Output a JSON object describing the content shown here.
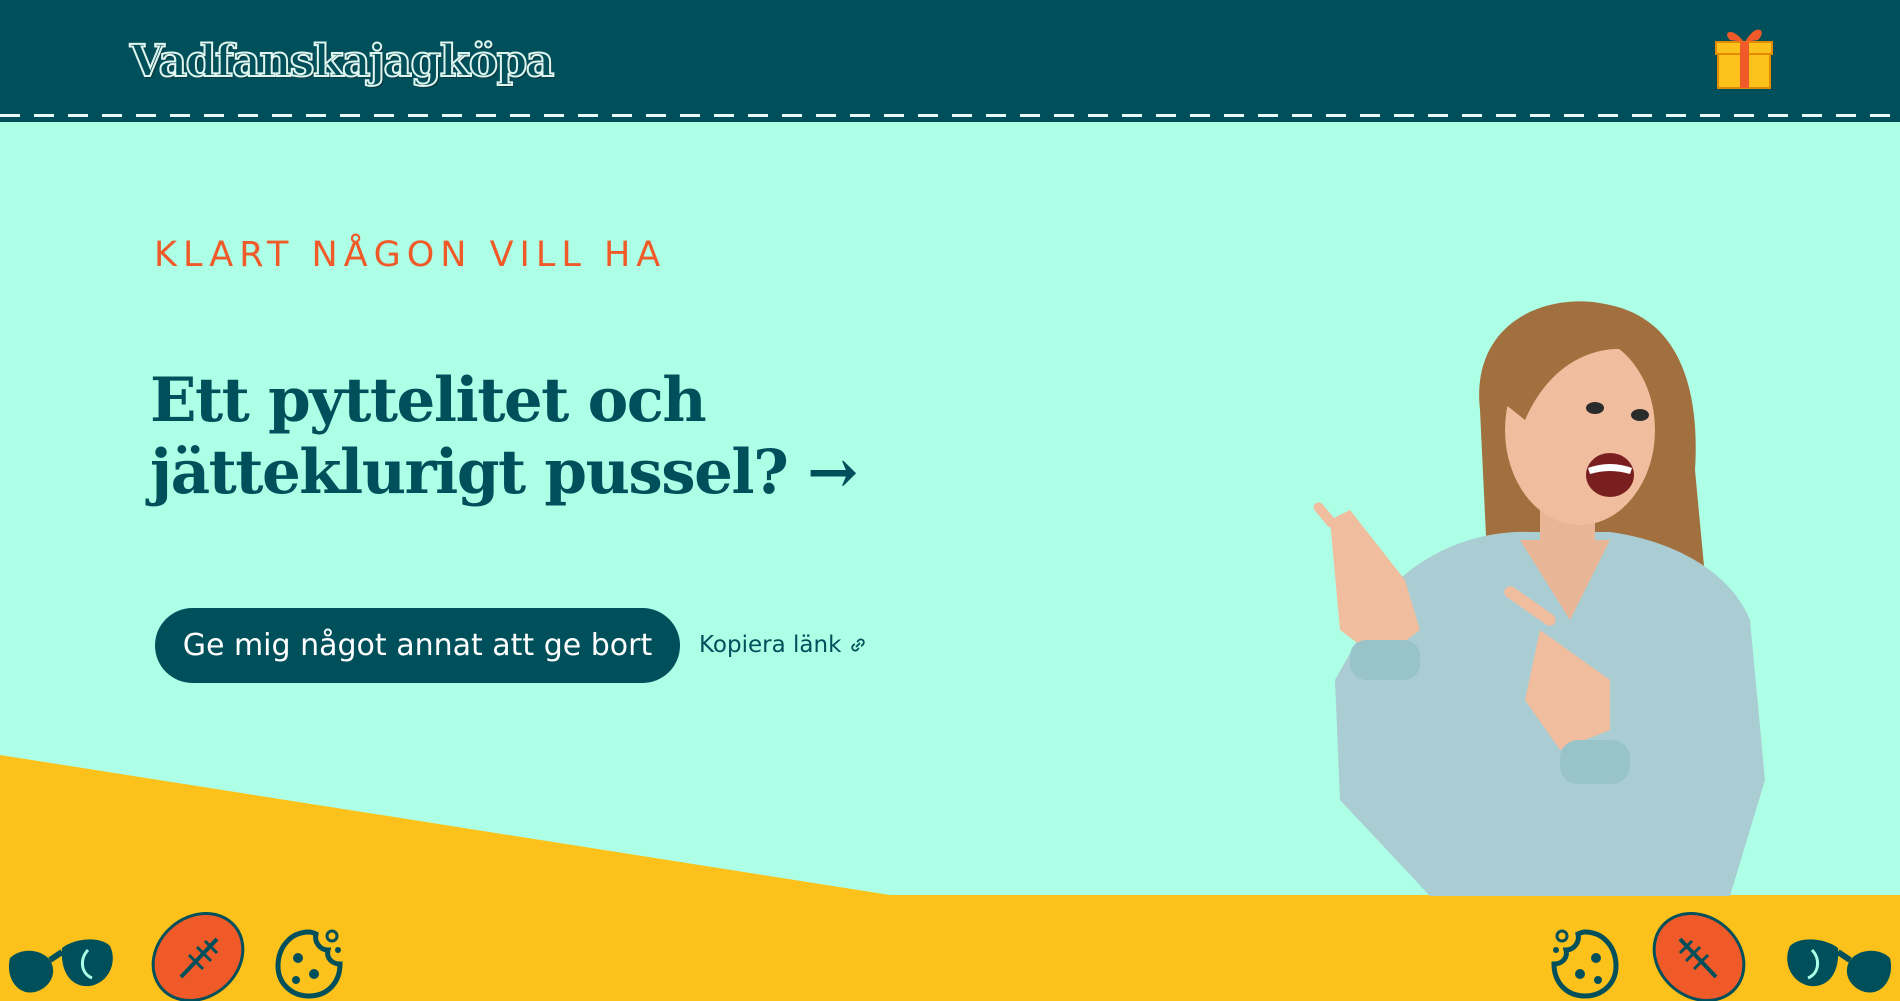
{
  "header": {
    "logo_text": "Vadfanskajagköpa",
    "gift_icon": "gift-icon"
  },
  "hero": {
    "eyebrow": "KLART NÅGON VILL HA",
    "headline_line1": "Ett pyttelitet och",
    "headline_line2": "jätteklurigt pussel? →",
    "cta_label": "Ge mig något annat att ge bort",
    "copy_link_label": "Kopiera länk",
    "copy_link_icon": "link-icon"
  },
  "colors": {
    "background": "#adffe6",
    "header": "#00505c",
    "accent": "#f05a28",
    "band": "#fcc21b",
    "primary": "#00505c"
  },
  "decorations": [
    "sunglasses-icon",
    "football-icon",
    "cookie-icon",
    "cookie-icon",
    "football-icon",
    "sunglasses-icon"
  ]
}
